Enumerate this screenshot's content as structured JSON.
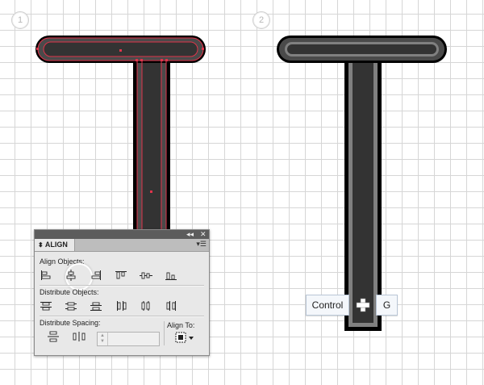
{
  "steps": [
    "1",
    "2"
  ],
  "colors": {
    "shape_outer": "#000000",
    "shape_ring": "#4a4a4a",
    "shape_stroke": "#808080",
    "shape_fill": "#333333",
    "selection": "#e0344b"
  },
  "align_panel": {
    "collapse_glyph": "◂◂",
    "close_glyph": "✕",
    "tab_label": "ALIGN",
    "tab_arrows": "⬍",
    "menu_glyph": "▾☰",
    "align_objects_label": "Align Objects:",
    "distribute_objects_label": "Distribute Objects:",
    "distribute_spacing_label": "Distribute Spacing:",
    "align_to_label": "Align To:",
    "align_objects_icons": [
      "horizontal-align-left-icon",
      "horizontal-align-center-icon",
      "horizontal-align-right-icon",
      "vertical-align-top-icon",
      "vertical-align-center-icon",
      "vertical-align-bottom-icon"
    ],
    "distribute_objects_icons": [
      "vertical-distribute-top-icon",
      "vertical-distribute-center-icon",
      "vertical-distribute-bottom-icon",
      "horizontal-distribute-left-icon",
      "horizontal-distribute-center-icon",
      "horizontal-distribute-right-icon"
    ],
    "distribute_spacing_icons": [
      "vertical-distribute-space-icon",
      "horizontal-distribute-space-icon"
    ],
    "highlighted_button": "horizontal-align-center-icon"
  },
  "shortcut": {
    "key1": "Control",
    "key2": "G"
  }
}
